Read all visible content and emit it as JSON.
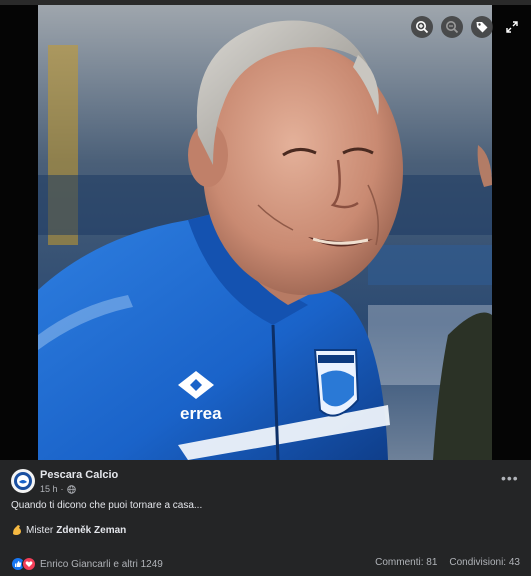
{
  "post": {
    "page_name": "Pescara Calcio",
    "time": "15 h",
    "separator": "·",
    "caption": "Quando ti dicono che puoi tornare a casa...",
    "mister_prefix": "Mister",
    "mister_name": "Zdeněk Zeman",
    "reactions_text": "Enrico Giancarli e altri 1249",
    "comments": "Commenti: 81",
    "shares": "Condivisioni: 43"
  },
  "photo_logo_text": "errea",
  "controls": [
    "zoom-in-icon",
    "zoom-out-icon",
    "tag-icon",
    "fullscreen-icon"
  ],
  "colors": {
    "panel_bg": "#242526",
    "viewer_bg": "#050505",
    "text_primary": "#e4e6eb",
    "text_secondary": "#b0b3b8",
    "like_blue": "#1877f2",
    "love_red": "#f33e58",
    "jacket_blue": "#1a63c9"
  }
}
